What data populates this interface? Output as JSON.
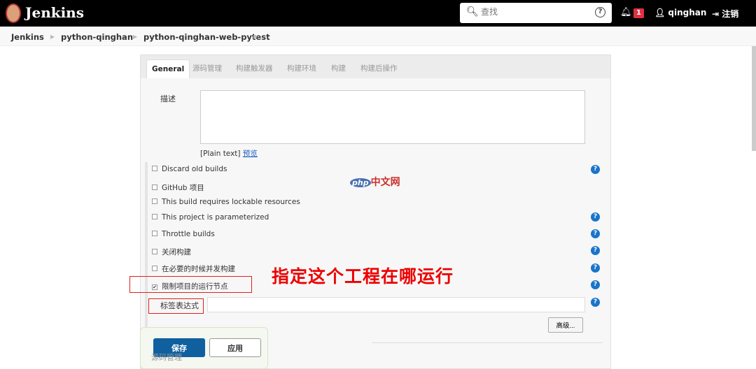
{
  "header": {
    "brand": "Jenkins",
    "search_placeholder": "查找",
    "notification_count": "1",
    "user": "qinghan",
    "logout": "注销",
    "icons": [
      "jenkins-logo",
      "search-icon",
      "help-icon",
      "bell-icon",
      "user-icon",
      "logout-icon"
    ]
  },
  "breadcrumb": [
    "Jenkins",
    "python-qinghan",
    "python-qinghan-web-pytest"
  ],
  "tabs": [
    "General",
    "源码管理",
    "构建触发器",
    "构建环境",
    "构建",
    "构建后操作"
  ],
  "description": {
    "label": "描述",
    "value": "",
    "plain_text": "[Plain text]",
    "preview": "预览"
  },
  "options": [
    {
      "label": "Discard old builds",
      "checked": false,
      "help": true
    },
    {
      "label": "GitHub 项目",
      "checked": false,
      "help": false
    },
    {
      "label": "This build requires lockable resources",
      "checked": false,
      "help": false
    },
    {
      "label": "This project is parameterized",
      "checked": false,
      "help": true
    },
    {
      "label": "Throttle builds",
      "checked": false,
      "help": true
    },
    {
      "label": "关闭构建",
      "checked": false,
      "help": true
    },
    {
      "label": "在必要的时候并发构建",
      "checked": false,
      "help": true
    },
    {
      "label": "限制项目的运行节点",
      "checked": true,
      "help": true
    }
  ],
  "label_expression": {
    "label": "标签表达式",
    "value": ""
  },
  "advanced": "高级...",
  "annotation": "指定这个工程在哪运行",
  "buttons": {
    "save": "保存",
    "apply": "应用"
  },
  "next_section": "源码管理",
  "watermark": {
    "text": "php中文网",
    "badge": "php",
    "suffix": "中文网"
  }
}
